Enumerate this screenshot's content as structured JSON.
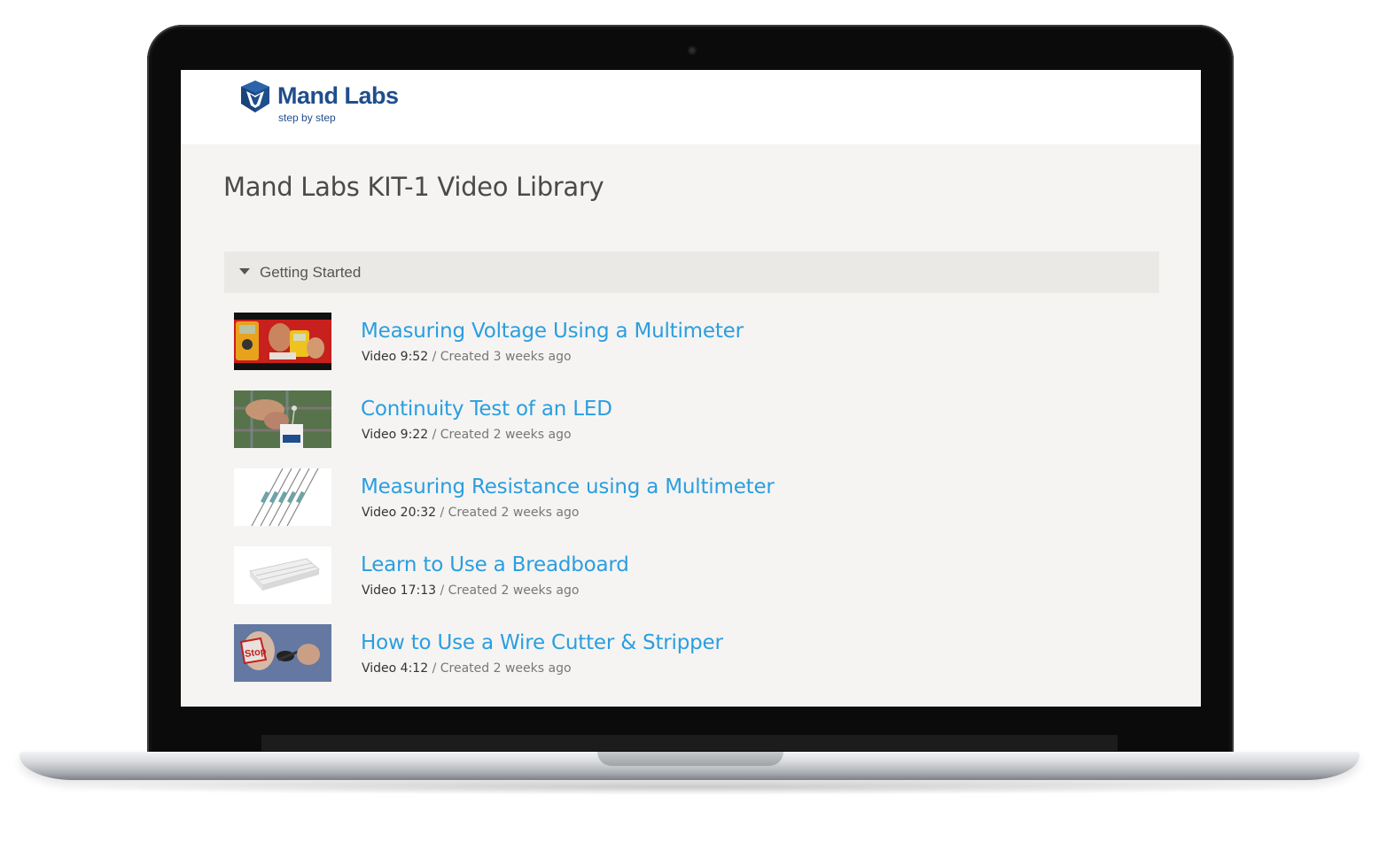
{
  "brand": {
    "name": "Mand Labs",
    "tagline": "step by step",
    "color": "#1f4e8c"
  },
  "page": {
    "title": "Mand Labs KIT-1 Video Library"
  },
  "section": {
    "label": "Getting Started",
    "expanded": true,
    "icon": "caret-down-icon"
  },
  "videos": [
    {
      "title": "Measuring Voltage Using a Multimeter",
      "type_duration": "Video 9:52",
      "created": " / Created 3 weeks ago"
    },
    {
      "title": "Continuity Test of an LED",
      "type_duration": "Video 9:22",
      "created": " / Created 2 weeks ago"
    },
    {
      "title": "Measuring Resistance using a Multimeter",
      "type_duration": "Video 20:32",
      "created": " / Created 2 weeks ago"
    },
    {
      "title": "Learn to Use a Breadboard",
      "type_duration": "Video 17:13",
      "created": " / Created 2 weeks ago"
    },
    {
      "title": "How to Use a Wire Cutter & Stripper",
      "type_duration": "Video 4:12",
      "created": " / Created 2 weeks ago"
    }
  ],
  "colors": {
    "link": "#2a9ee0",
    "page_bg": "#f5f4f2",
    "section_bg": "#ebe9e6"
  }
}
